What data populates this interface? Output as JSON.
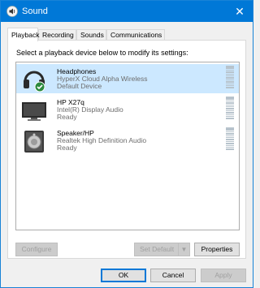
{
  "window": {
    "title": "Sound",
    "close_glyph": "✕"
  },
  "tabs": [
    {
      "label": "Playback",
      "active": true
    },
    {
      "label": "Recording",
      "active": false
    },
    {
      "label": "Sounds",
      "active": false
    },
    {
      "label": "Communications",
      "active": false
    }
  ],
  "panel": {
    "instruction": "Select a playback device below to modify its settings:"
  },
  "devices": [
    {
      "name": "Headphones",
      "description": "HyperX Cloud Alpha Wireless",
      "status": "Default Device",
      "selected": true,
      "icon": "headphones-icon"
    },
    {
      "name": "HP X27q",
      "description": "Intel(R) Display Audio",
      "status": "Ready",
      "selected": false,
      "icon": "monitor-icon"
    },
    {
      "name": "Speaker/HP",
      "description": "Realtek High Definition Audio",
      "status": "Ready",
      "selected": false,
      "icon": "speaker-icon"
    }
  ],
  "buttons": {
    "configure": "Configure",
    "set_default": "Set Default",
    "set_default_arrow": "▼",
    "properties": "Properties",
    "ok": "OK",
    "cancel": "Cancel",
    "apply": "Apply"
  },
  "colors": {
    "titlebar": "#0078d7",
    "selection": "#cce8ff",
    "default_check": "#2c8a3e"
  }
}
